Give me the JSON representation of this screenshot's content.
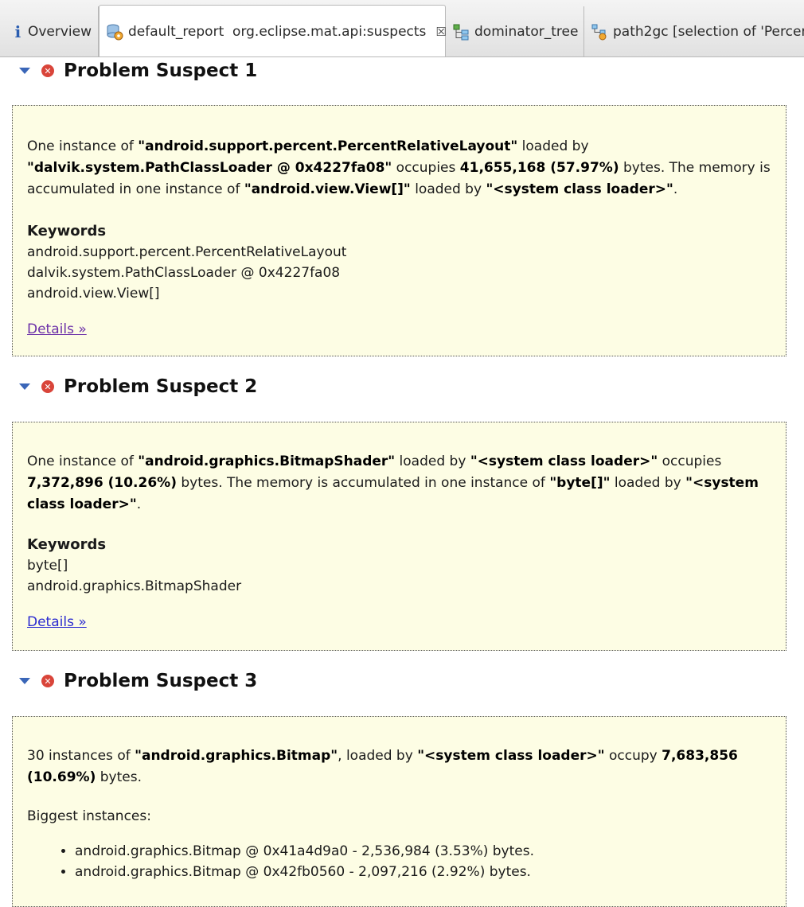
{
  "tabs": [
    {
      "label": "Overview",
      "icon": "info-icon"
    },
    {
      "label": "default_report  org.eclipse.mat.api:suspects",
      "icon": "report-icon",
      "close": "☒"
    },
    {
      "label": "dominator_tree",
      "icon": "dominator-tree-icon"
    },
    {
      "label": "path2gc [selection of 'Percen",
      "icon": "path2gc-icon"
    }
  ],
  "suspects": [
    {
      "title": "Problem Suspect 1",
      "p_prefix1": "One instance of ",
      "p_b1": "\"android.support.percent.PercentRelativeLayout\"",
      "p_mid1": " loaded by ",
      "p_b2": "\"dalvik.system.PathClassLoader @ 0x4227fa08\"",
      "p_mid2": " occupies ",
      "p_b3": "41,655,168 (57.97%)",
      "p_mid3": " bytes. The memory is accumulated in one instance of ",
      "p_b4": "\"android.view.View[]\"",
      "p_mid4": " loaded by ",
      "p_b5": "\"<system class loader>\"",
      "p_end": ".",
      "keywords_title": "Keywords",
      "keywords": [
        "android.support.percent.PercentRelativeLayout",
        "dalvik.system.PathClassLoader @ 0x4227fa08",
        "android.view.View[]"
      ],
      "details": "Details »"
    },
    {
      "title": "Problem Suspect 2",
      "p_prefix1": "One instance of ",
      "p_b1": "\"android.graphics.BitmapShader\"",
      "p_mid1": " loaded by ",
      "p_b2": "\"<system class loader>\"",
      "p_mid2": " occupies ",
      "p_b3": "7,372,896 (10.26%)",
      "p_mid3": " bytes. The memory is accumulated in one instance of ",
      "p_b4": "\"byte[]\"",
      "p_mid4": " loaded by ",
      "p_b5": "\"<system class loader>\"",
      "p_end": ".",
      "keywords_title": "Keywords",
      "keywords": [
        "byte[]",
        "android.graphics.BitmapShader"
      ],
      "details": "Details »"
    },
    {
      "title": "Problem Suspect 3",
      "p_prefix1": "30 instances of ",
      "p_b1": "\"android.graphics.Bitmap\"",
      "p_mid1": ", loaded by ",
      "p_b2": "\"<system class loader>\"",
      "p_mid2": " occupy ",
      "p_b3": "7,683,856 (10.69%)",
      "p_end": " bytes.",
      "biggest_title": "Biggest instances:",
      "biggest": [
        "android.graphics.Bitmap @ 0x41a4d9a0 - 2,536,984 (3.53%) bytes.",
        "android.graphics.Bitmap @ 0x42fb0560 - 2,097,216 (2.92%) bytes."
      ]
    }
  ]
}
